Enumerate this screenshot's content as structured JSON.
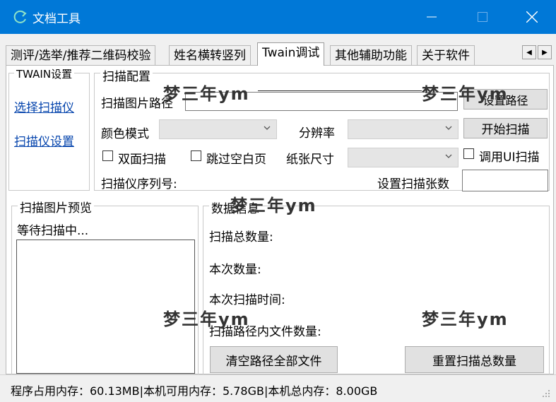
{
  "window": {
    "title": "文档工具"
  },
  "tabs": [
    "测评/选举/推荐二维码校验",
    "姓名横转竖列",
    "Twain调试",
    "其他辅助功能",
    "关于软件"
  ],
  "twain_group": {
    "legend": "TWAIN设置",
    "select_scanner": "选择扫描仪",
    "scanner_settings": "扫描仪设置"
  },
  "scan_config": {
    "legend": "扫描配置",
    "path_label": "扫描图片路径",
    "path_value": "",
    "set_path_button": "设置路径",
    "color_mode_label": "颜色模式",
    "color_mode_value": "",
    "resolution_label": "分辨率",
    "resolution_value": "",
    "start_scan_button": "开始扫描",
    "duplex_label": "双面扫描",
    "skip_blank_label": "跳过空白页",
    "paper_size_label": "纸张尺寸",
    "paper_size_value": "",
    "use_ui_label": "调用UI扫描",
    "serial_label": "扫描仪序列号:",
    "set_count_label": "设置扫描张数",
    "set_count_value": ""
  },
  "preview": {
    "legend": "扫描图片预览",
    "status": "等待扫描中..."
  },
  "data_info": {
    "legend": "数据信息",
    "total_label": "扫描总数量:",
    "current_label": "本次数量:",
    "time_label": "本次扫描时间:",
    "files_label": "扫描路径内文件数量:",
    "clear_button": "清空路径全部文件",
    "reset_button": "重置扫描总数量"
  },
  "watermark": "梦三年ym",
  "status_bar": {
    "text": "程序占用内存：60.13MB|本机可用内存：5.78GB|本机总内存：8.00GB"
  }
}
